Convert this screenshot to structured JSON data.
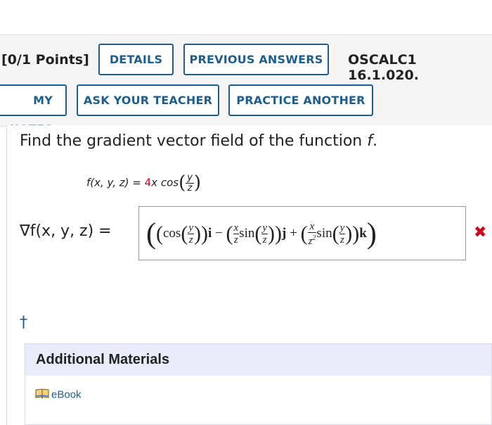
{
  "header": {
    "points": "[0/1 Points]",
    "question_id": "OSCALC1 16.1.020.",
    "buttons": {
      "details": "DETAILS",
      "previous_answers": "PREVIOUS ANSWERS",
      "my_notes": "MY NOTES",
      "ask_teacher": "ASK YOUR TEACHER",
      "practice_another": "PRACTICE ANOTHER"
    }
  },
  "question": {
    "prompt_prefix": "Find the gradient vector field of the function ",
    "prompt_var": "f",
    "prompt_suffix": ".",
    "function_lhs": "f(x, y, z) = ",
    "function_coef": "4",
    "function_rest": "x cos",
    "frac_num": "y",
    "frac_den": "z"
  },
  "answer": {
    "label": "∇f(x, y, z)",
    "equals": " = ",
    "cos": "cos",
    "sin": "sin",
    "i": "i",
    "j": "j",
    "k": "k",
    "x": "x",
    "y": "y",
    "z": "z",
    "z2": "z",
    "z2_exp": "2",
    "status": "incorrect"
  },
  "icons": {
    "incorrect": "✖",
    "dagger": "†"
  },
  "materials": {
    "title": "Additional Materials",
    "ebook": "eBook"
  },
  "colors": {
    "accent": "#1d5e8f",
    "error": "#d0021b",
    "materials_header": "#eaedf9"
  }
}
